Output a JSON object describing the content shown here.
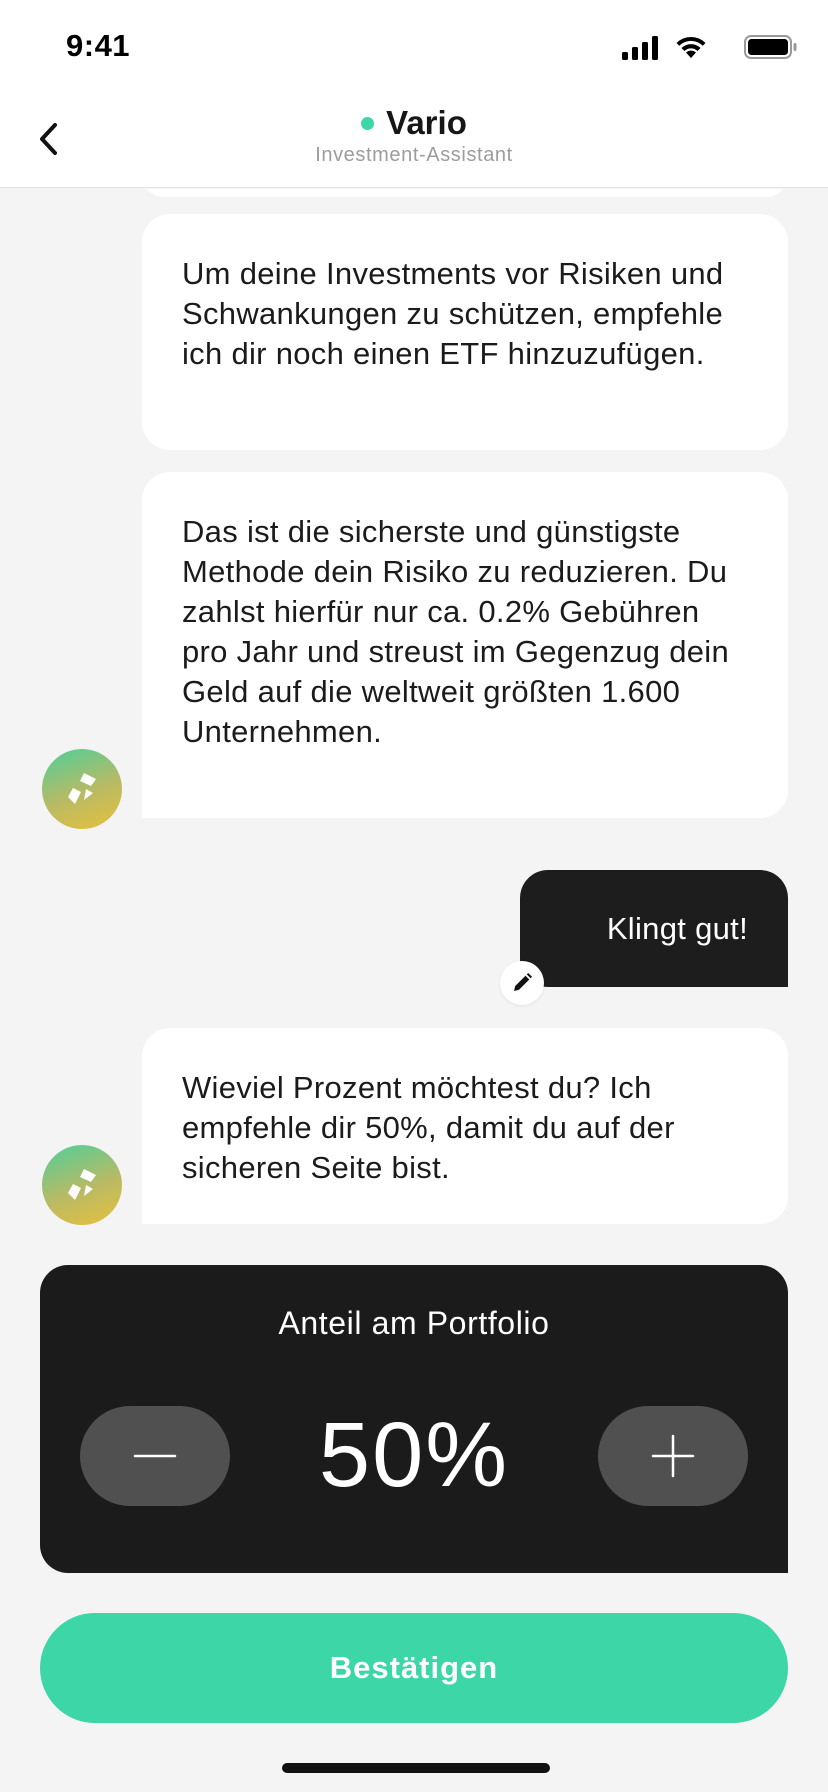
{
  "status_bar": {
    "time": "9:41",
    "icons": [
      "cellular-signal-icon",
      "wifi-icon",
      "battery-icon"
    ]
  },
  "header": {
    "title": "Vario",
    "subtitle": "Investment-Assistant",
    "online_color": "#3dd6a7",
    "back_icon": "chevron-left-icon"
  },
  "messages": [
    {
      "from": "assistant",
      "text": "Um deine Investments vor Risiken und Schwankungen zu schützen, empfehle ich dir noch einen ETF hinzuzufügen."
    },
    {
      "from": "assistant",
      "text": "Das ist die sicherste und günstigste Methode dein Risiko zu reduzieren. Du zahlst hierfür nur ca. 0.2% Gebühren pro Jahr und streust im Gegenzug dein Geld auf die weltweit größten 1.600 Unternehmen."
    },
    {
      "from": "user",
      "text": "Klingt gut!"
    },
    {
      "from": "assistant",
      "text": "Wieviel Prozent möchtest du? Ich empfehle dir 50%, damit du auf der sicheren Seite bist."
    }
  ],
  "portfolio": {
    "label": "Anteil am Portfolio",
    "value": "50%",
    "minus_icon": "minus-icon",
    "plus_icon": "plus-icon"
  },
  "confirm_label": "Bestätigen",
  "colors": {
    "accent": "#3dd6a7",
    "card_dark": "#1b1b1b",
    "stepper_button": "#505050",
    "background": "#f4f4f4"
  }
}
